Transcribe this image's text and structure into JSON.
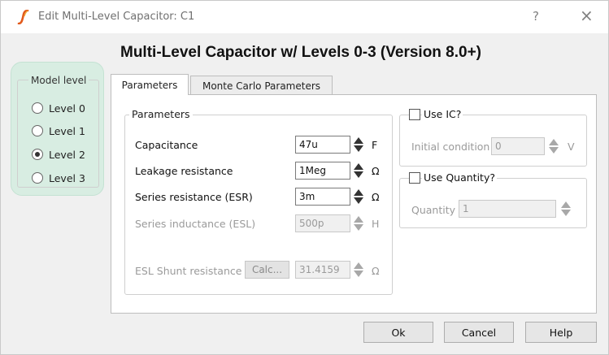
{
  "window": {
    "title": "Edit Multi-Level Capacitor: C1",
    "help_glyph": "?",
    "close_glyph": "×"
  },
  "heading": "Multi-Level Capacitor w/ Levels 0-3 (Version 8.0+)",
  "model_level": {
    "title": "Model level",
    "options": [
      "Level 0",
      "Level 1",
      "Level 2",
      "Level 3"
    ],
    "selected": "Level 2"
  },
  "tabs": [
    {
      "label": "Parameters",
      "active": true
    },
    {
      "label": "Monte Carlo Parameters",
      "active": false
    }
  ],
  "parameters": {
    "group_title": "Parameters",
    "rows": [
      {
        "label": "Capacitance",
        "value": "47u",
        "unit": "F",
        "enabled": true
      },
      {
        "label": "Leakage resistance",
        "value": "1Meg",
        "unit": "Ω",
        "enabled": true
      },
      {
        "label": "Series resistance (ESR)",
        "value": "3m",
        "unit": "Ω",
        "enabled": true
      },
      {
        "label": "Series inductance (ESL)",
        "value": "500p",
        "unit": "H",
        "enabled": false
      },
      {
        "label": "ESL Shunt resistance",
        "value": "31.4159",
        "unit": "Ω",
        "enabled": false
      }
    ],
    "calc_label": "Calc..."
  },
  "use_ic": {
    "label": "Use IC?",
    "checked": false,
    "field_label": "Initial condition",
    "value": "0",
    "unit": "V"
  },
  "use_quantity": {
    "label": "Use Quantity?",
    "checked": false,
    "field_label": "Quantity",
    "value": "1"
  },
  "buttons": {
    "ok": "Ok",
    "cancel": "Cancel",
    "help": "Help"
  },
  "colors": {
    "model_level_highlight": "#d8ede2",
    "app_icon": "#e25a1c"
  },
  "icons": {
    "app": "app-logo-icon",
    "spin": "spin-arrows-icon"
  }
}
